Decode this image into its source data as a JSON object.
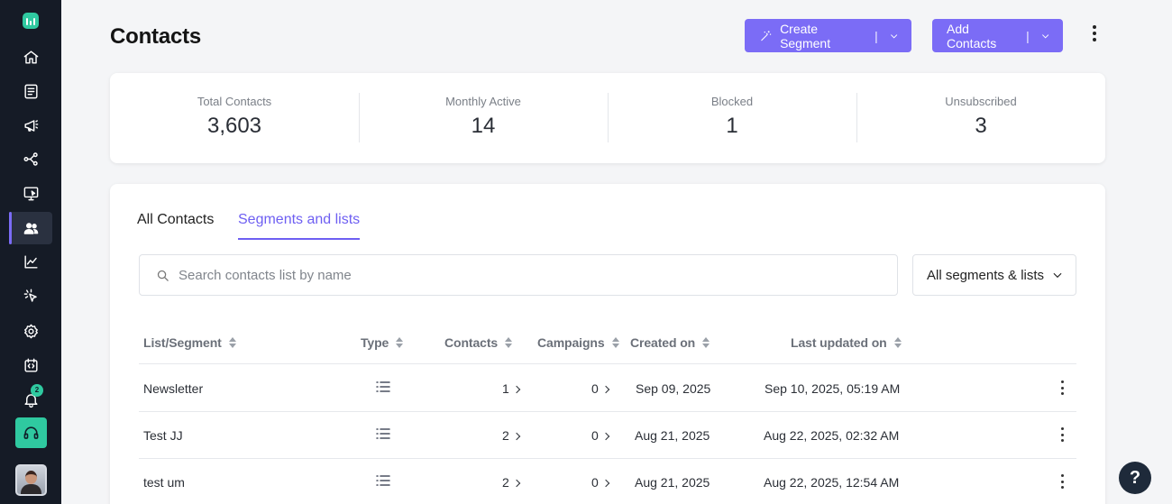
{
  "sidebar": {
    "items": [
      {
        "name": "home-icon"
      },
      {
        "name": "document-icon"
      },
      {
        "name": "megaphone-icon"
      },
      {
        "name": "automation-icon"
      },
      {
        "name": "monitor-icon"
      },
      {
        "name": "contacts-icon",
        "active": true
      },
      {
        "name": "chart-icon"
      },
      {
        "name": "cursor-click-icon"
      },
      {
        "name": "settings-icon"
      },
      {
        "name": "code-icon"
      },
      {
        "name": "bell-icon",
        "badge": "2"
      }
    ]
  },
  "header": {
    "title": "Contacts",
    "create_segment_label": "Create Segment",
    "add_contacts_label": "Add Contacts",
    "separator": "|"
  },
  "stats": [
    {
      "label": "Total Contacts",
      "value": "3,603"
    },
    {
      "label": "Monthly Active",
      "value": "14"
    },
    {
      "label": "Blocked",
      "value": "1"
    },
    {
      "label": "Unsubscribed",
      "value": "3"
    }
  ],
  "tabs": [
    {
      "label": "All Contacts",
      "active": false
    },
    {
      "label": "Segments and lists",
      "active": true
    }
  ],
  "search": {
    "placeholder": "Search contacts list by name",
    "value": ""
  },
  "filter": {
    "selected": "All segments & lists"
  },
  "table": {
    "columns": [
      "List/Segment",
      "Type",
      "Contacts",
      "Campaigns",
      "Created on",
      "Last updated on"
    ],
    "rows": [
      {
        "name": "Newsletter",
        "type": "list-icon",
        "contacts": "1",
        "campaigns": "0",
        "created": "Sep 09, 2025",
        "updated": "Sep 10, 2025, 05:19 AM"
      },
      {
        "name": "Test JJ",
        "type": "list-icon",
        "contacts": "2",
        "campaigns": "0",
        "created": "Aug 21, 2025",
        "updated": "Aug 22, 2025, 02:32 AM"
      },
      {
        "name": "test um",
        "type": "list-icon",
        "contacts": "2",
        "campaigns": "0",
        "created": "Aug 21, 2025",
        "updated": "Aug 22, 2025, 12:54 AM"
      }
    ]
  },
  "help": {
    "label": "?"
  },
  "colors": {
    "accent": "#7b6cf6",
    "sidebar": "#151b26",
    "brand_green": "#2fc9a0"
  }
}
